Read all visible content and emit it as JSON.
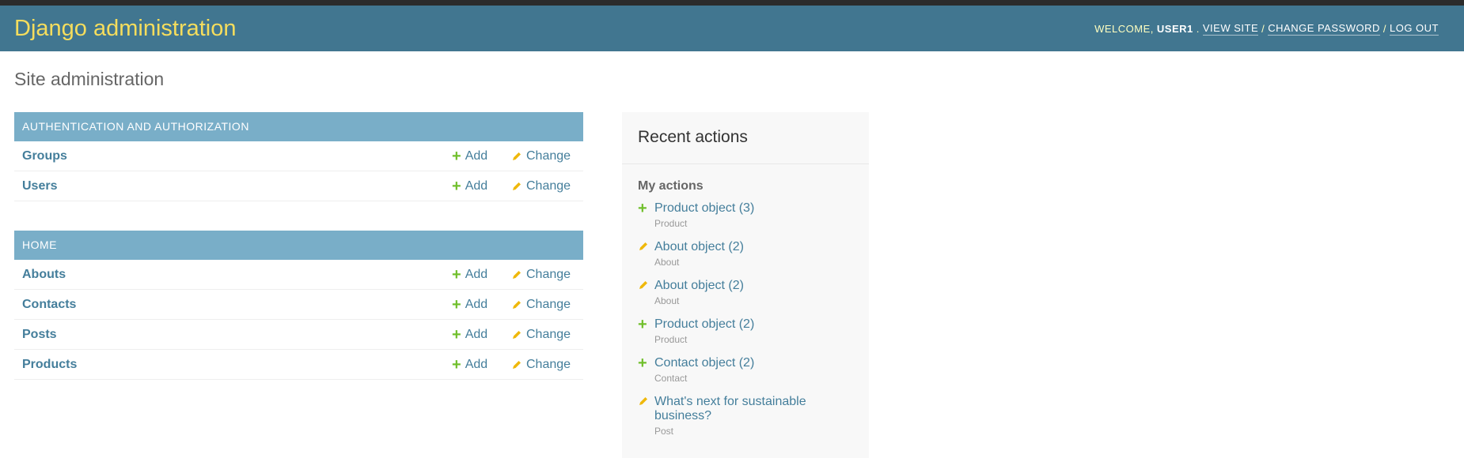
{
  "header": {
    "brand": "Django administration",
    "welcome": "WELCOME,",
    "user": "USER1",
    "view_site": "VIEW SITE",
    "change_password": "CHANGE PASSWORD",
    "log_out": "LOG OUT"
  },
  "page_title": "Site administration",
  "modules": [
    {
      "caption": "Authentication and Authorization",
      "rows": [
        {
          "name": "Groups",
          "add": "Add",
          "change": "Change"
        },
        {
          "name": "Users",
          "add": "Add",
          "change": "Change"
        }
      ]
    },
    {
      "caption": "Home",
      "rows": [
        {
          "name": "Abouts",
          "add": "Add",
          "change": "Change"
        },
        {
          "name": "Contacts",
          "add": "Add",
          "change": "Change"
        },
        {
          "name": "Posts",
          "add": "Add",
          "change": "Change"
        },
        {
          "name": "Products",
          "add": "Add",
          "change": "Change"
        }
      ]
    }
  ],
  "recent": {
    "title": "Recent actions",
    "subtitle": "My actions",
    "items": [
      {
        "icon": "plus-icon",
        "label": "Product object (3)",
        "type": "Product"
      },
      {
        "icon": "pencil-icon",
        "label": "About object (2)",
        "type": "About"
      },
      {
        "icon": "pencil-icon",
        "label": "About object (2)",
        "type": "About"
      },
      {
        "icon": "plus-icon",
        "label": "Product object (2)",
        "type": "Product"
      },
      {
        "icon": "plus-icon",
        "label": "Contact object (2)",
        "type": "Contact"
      },
      {
        "icon": "pencil-icon",
        "label": "What's next for sustainable business?",
        "type": "Post"
      }
    ]
  },
  "colors": {
    "header_bg": "#417690",
    "brand": "#f5dd5d",
    "caption_bg": "#79aec8",
    "link": "#447e9b",
    "add_green": "#70bf2b",
    "change_yellow": "#efb80b"
  }
}
